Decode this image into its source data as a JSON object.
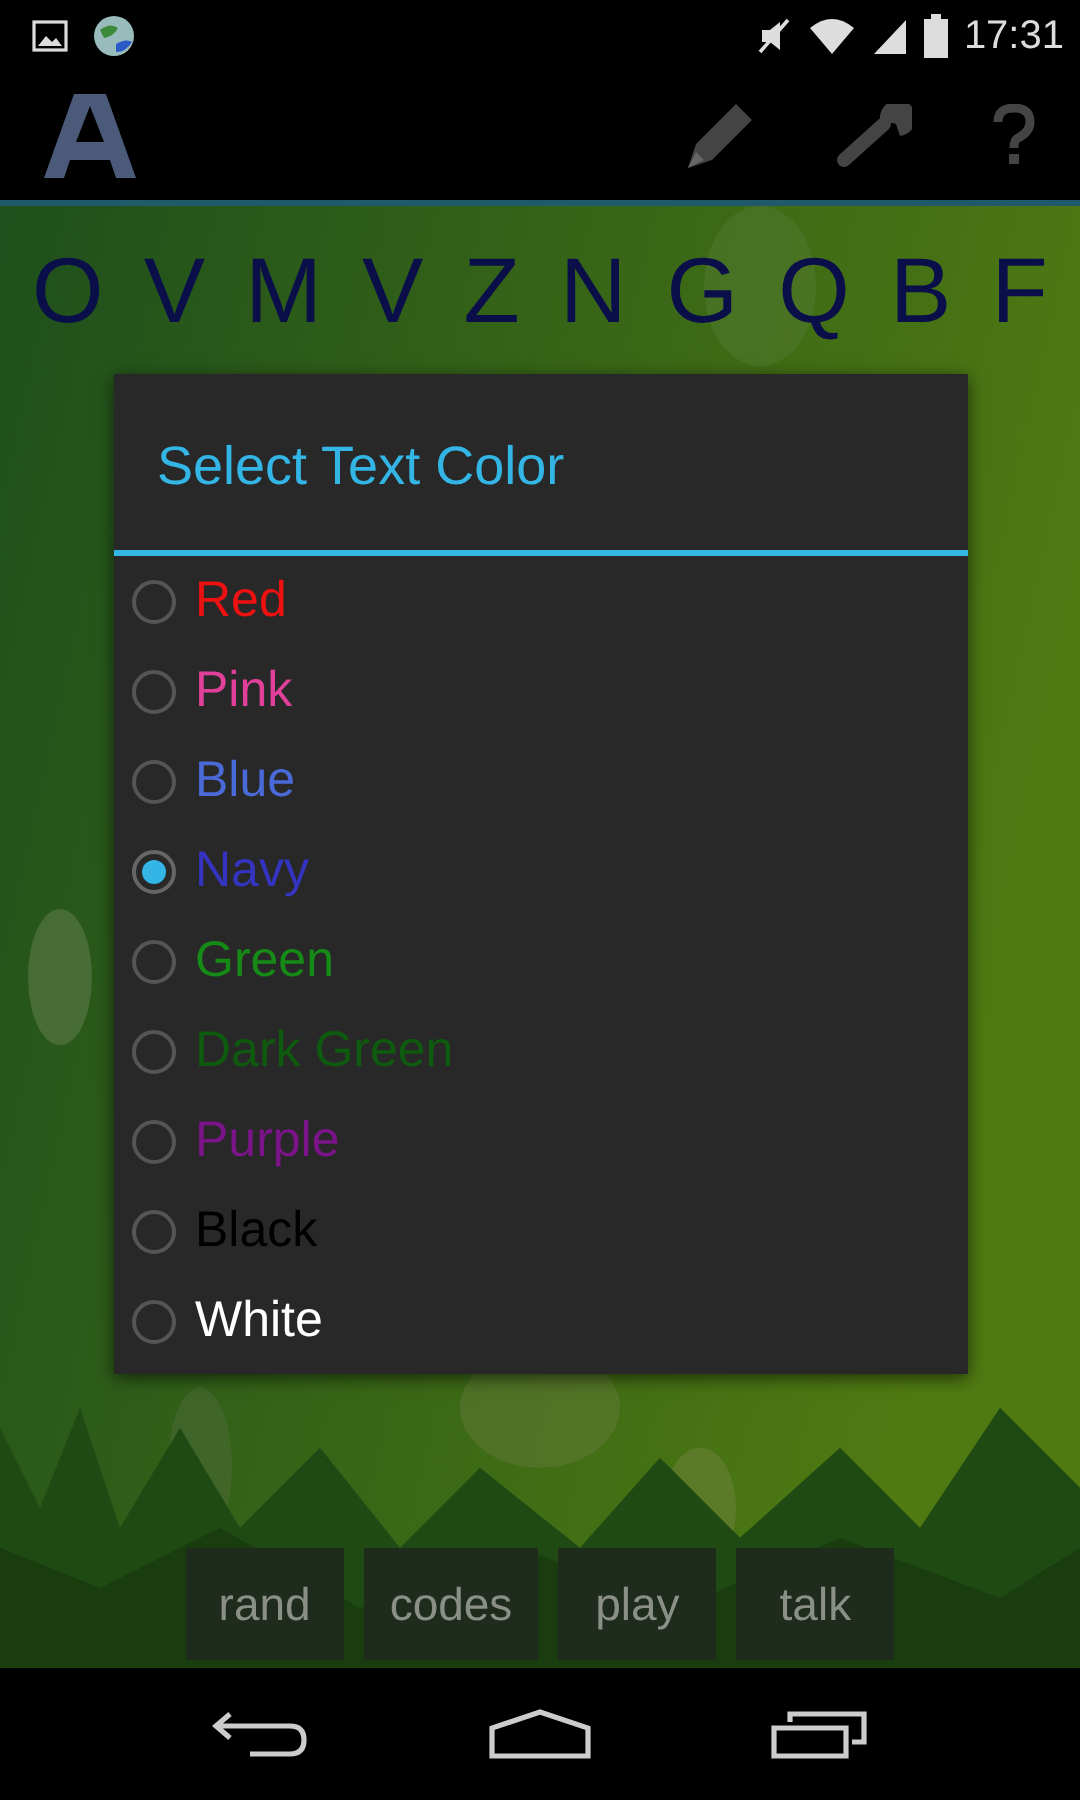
{
  "status_bar": {
    "time": "17:31"
  },
  "letters": [
    "O",
    "V",
    "M",
    "V",
    "Z",
    "N",
    "G",
    "Q",
    "B",
    "F"
  ],
  "dialog": {
    "title": "Select Text Color",
    "options": [
      {
        "label": "Red",
        "color": "#ee1111",
        "selected": false
      },
      {
        "label": "Pink",
        "color": "#e0409a",
        "selected": false
      },
      {
        "label": "Blue",
        "color": "#4a6ad8",
        "selected": false
      },
      {
        "label": "Navy",
        "color": "#3434c0",
        "selected": true
      },
      {
        "label": "Green",
        "color": "#168a16",
        "selected": false
      },
      {
        "label": "Dark Green",
        "color": "#0e5a0e",
        "selected": false
      },
      {
        "label": "Purple",
        "color": "#7a1488",
        "selected": false
      },
      {
        "label": "Black",
        "color": "#000000",
        "selected": false
      },
      {
        "label": "White",
        "color": "#ffffff",
        "selected": false
      }
    ]
  },
  "buttons": [
    "rand",
    "codes",
    "play",
    "talk"
  ]
}
